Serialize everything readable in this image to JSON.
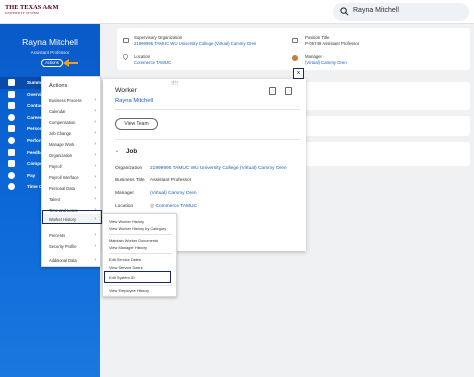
{
  "header": {
    "logo_main": "THE TEXAS A&M",
    "logo_sub": "UNIVERSITY SYSTEM",
    "search_value": "Rayna Mitchell"
  },
  "profile": {
    "name": "Rayna Mitchell",
    "title": "Assistant Professor",
    "actions_label": "Actions"
  },
  "nav": {
    "items": [
      {
        "label": "Summ",
        "icon": "grid-icon"
      },
      {
        "label": "Overvie",
        "icon": "document-icon"
      },
      {
        "label": "Contact",
        "icon": "contact-card-icon"
      },
      {
        "label": "Career",
        "icon": "briefcase-icon"
      },
      {
        "label": "Person",
        "icon": "person-icon"
      },
      {
        "label": "Perform",
        "icon": "target-icon"
      },
      {
        "label": "Feedba",
        "icon": "chat-icon"
      },
      {
        "label": "Compe",
        "icon": "money-icon"
      },
      {
        "label": "Pay",
        "icon": "dollar-icon"
      },
      {
        "label": "Time O",
        "icon": "clock-icon"
      }
    ]
  },
  "actions_menu": {
    "heading": "Actions",
    "items": [
      "Business Process",
      "Calendar",
      "Compensation",
      "Job Change",
      "Manage Work",
      "Organization",
      "Payroll",
      "Payroll Interface",
      "Personal Data",
      "Talent",
      "Time and Leave",
      "Worker History",
      "Percents",
      "Security Profile",
      "Additional Data"
    ]
  },
  "worker_history_menu": {
    "items": [
      "View Worker History",
      "View Worker History by Category",
      "Maintain Worker Documents",
      "View Manager History",
      "Edit Service Dates",
      "View Service Dates",
      "Edit System ID",
      "View Employee History"
    ]
  },
  "org_card": {
    "sup_org_label": "Supervisory Organization",
    "sup_org_value": "21999995 TAMUC WU University College (Virtual) Cammy Oren",
    "location_label": "Location",
    "location_value": "Commerce TAMUC",
    "position_label": "Position Title",
    "position_value": "P-05749 Assistant Professor",
    "manager_label": "Manager",
    "manager_value": "(Virtual) Cammy Oren"
  },
  "worker_popup": {
    "title": "Worker",
    "name": "Rayna Mitchell",
    "view_team": "View Team",
    "job_heading": "Job",
    "org_label": "Organization",
    "org_value": "21999995 TAMUC WU University College (Virtual) Cammy Oren",
    "business_title_label": "Business Title",
    "business_title_value": "Assistant Professor",
    "manager_label": "Manager",
    "manager_value": "(Virtual) Cammy Oren",
    "location_label": "Location",
    "location_value": "Commerce TAMUC"
  },
  "colors": {
    "brand_maroon": "#5b0013",
    "panel_blue": "#0b66d6",
    "link_blue": "#1a5fb4",
    "highlight_border": "#1a2a5a",
    "arrow_orange": "#f0a020"
  }
}
